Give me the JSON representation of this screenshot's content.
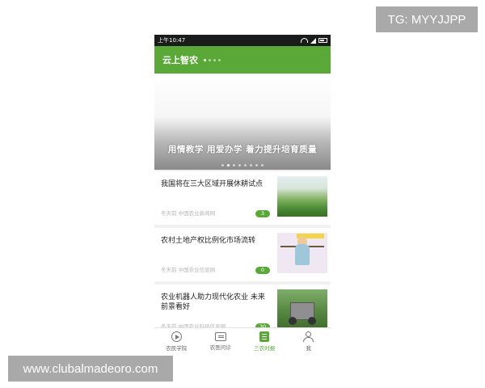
{
  "watermarks": {
    "top_right": "TG: MYYJJPP",
    "bottom_left": "www.clubalmadeoro.com"
  },
  "status_bar": {
    "time": "上午10:47"
  },
  "app": {
    "title": "云上智农",
    "accent_color": "#5aa838"
  },
  "banner": {
    "caption": "用情教学 用爱办学 着力提升培育质量"
  },
  "news": [
    {
      "title": "我国将在三大区域开展休耕试点",
      "meta": "冬天前  中国农业新闻网",
      "count": "3",
      "thumb": "farmland-image"
    },
    {
      "title": "农村土地产权比例化市场流转",
      "meta": "冬天前  中国农业信息网",
      "count": "0",
      "thumb": "cartoon-image"
    },
    {
      "title": "农业机器人助力现代化农业 未来前景看好",
      "meta": "冬天前  中国农业科技信息网",
      "count": "30",
      "thumb": "machine-image"
    }
  ],
  "tabs": [
    {
      "label": "农民学院",
      "icon": "play-icon"
    },
    {
      "label": "农医问诊",
      "icon": "chat-icon"
    },
    {
      "label": "三农时报",
      "icon": "news-icon"
    },
    {
      "label": "我",
      "icon": "user-icon"
    }
  ]
}
